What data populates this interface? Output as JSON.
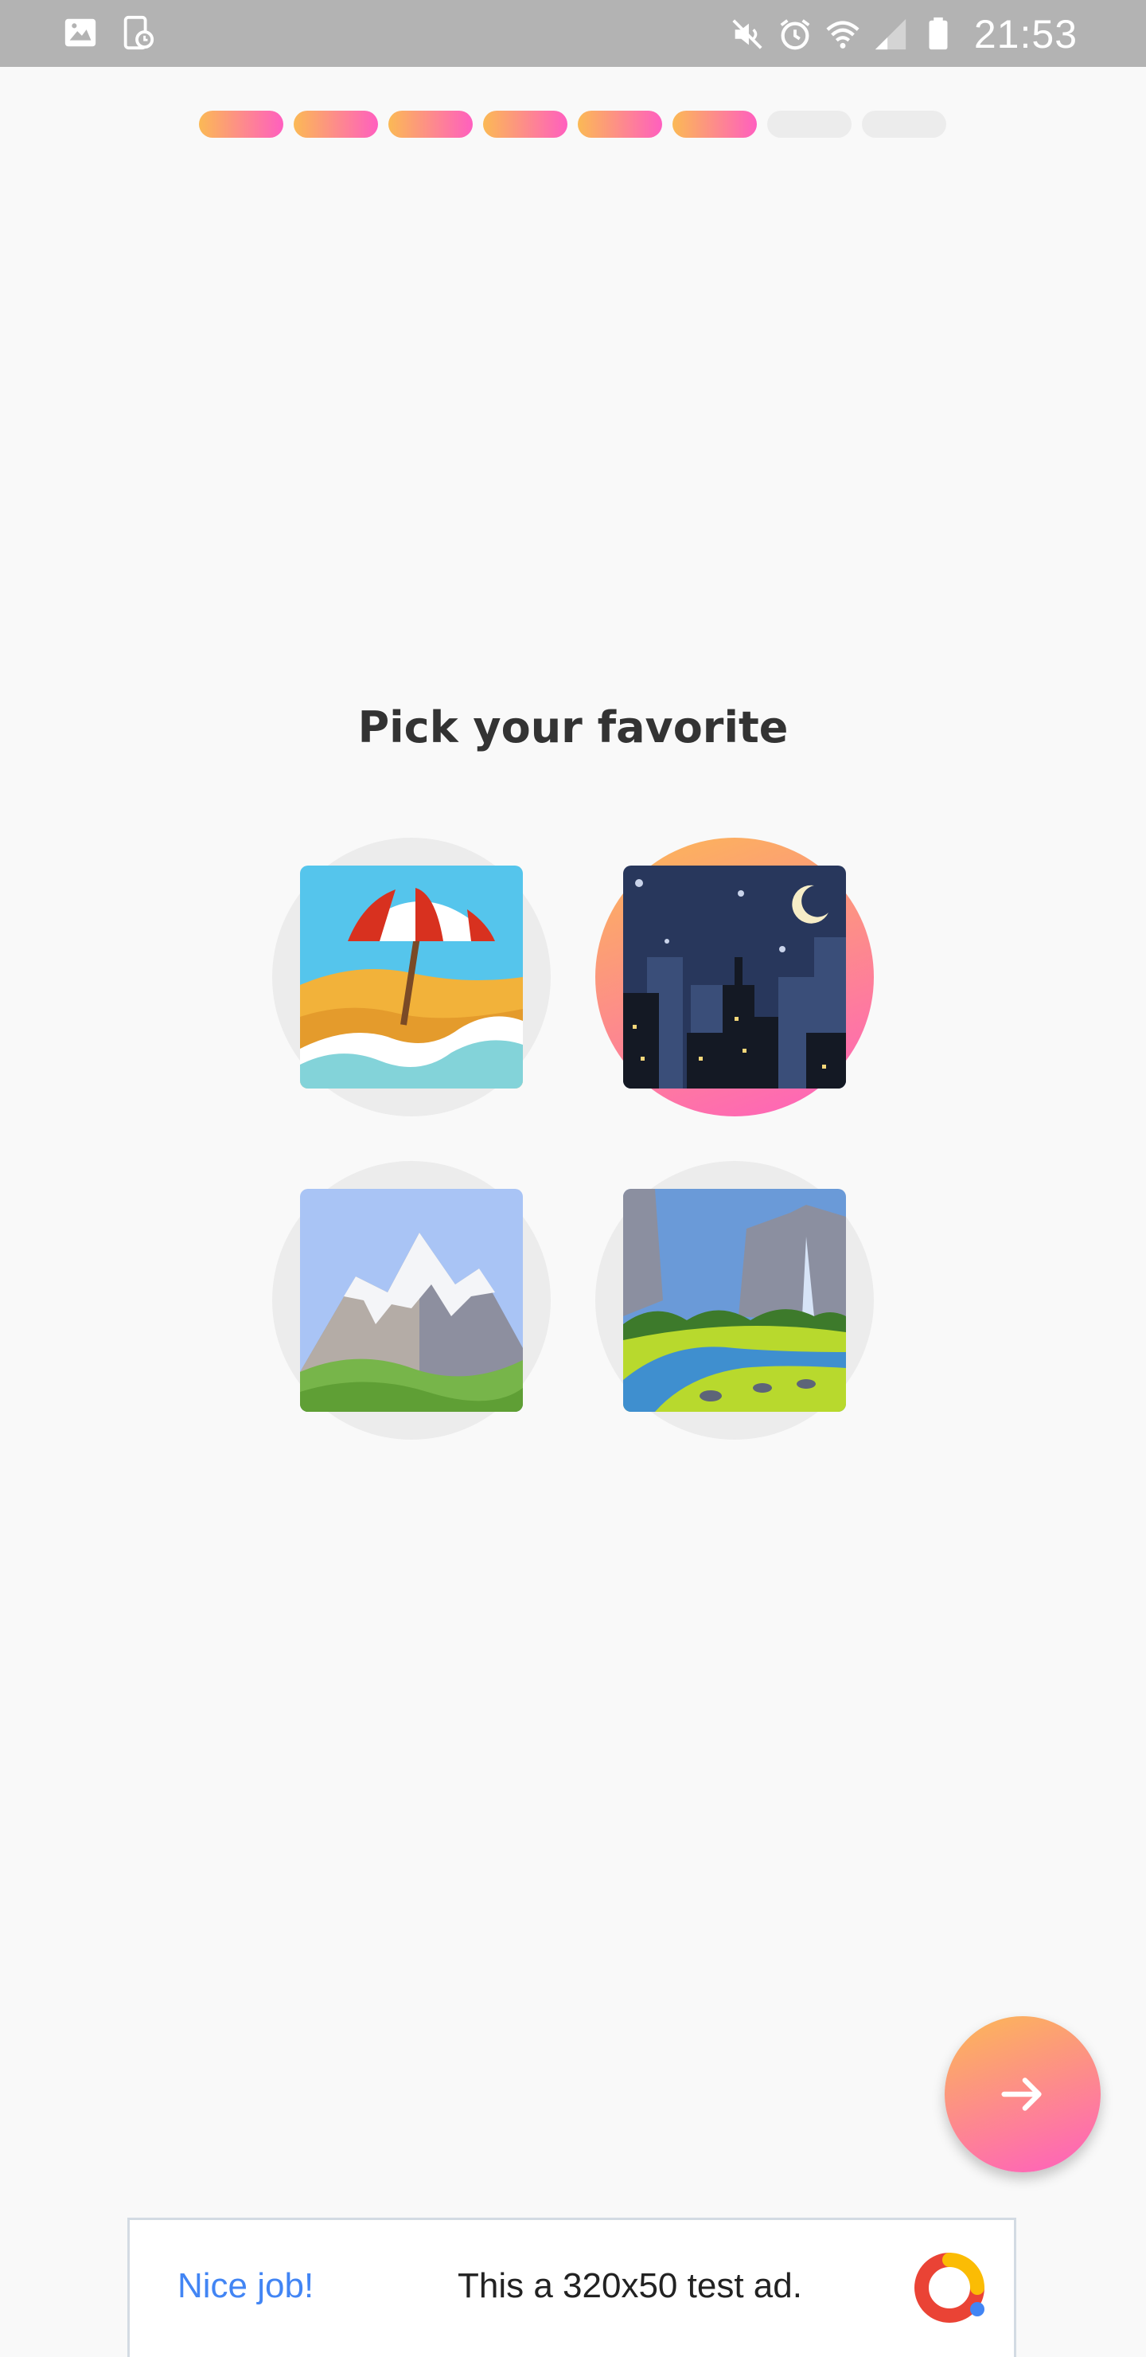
{
  "status_bar": {
    "time": "21:53",
    "left_icons": [
      "image-icon",
      "screenshot-icon"
    ],
    "right_icons": [
      "mute-icon",
      "alarm-icon",
      "wifi-icon",
      "signal-icon",
      "battery-icon"
    ]
  },
  "progress": {
    "total_steps": 8,
    "completed_steps": 6
  },
  "title": "Pick your favorite",
  "options": [
    {
      "name": "beach-with-umbrella",
      "selected": false
    },
    {
      "name": "night-with-stars",
      "selected": true
    },
    {
      "name": "snow-capped-mountain",
      "selected": false
    },
    {
      "name": "national-park",
      "selected": false
    }
  ],
  "next_button": {
    "icon": "arrow-right-icon"
  },
  "ad": {
    "label": "Nice job!",
    "text": "This a 320x50 test ad.",
    "logo": "ad-logo-icon"
  },
  "colors": {
    "accent_start": "#fbb955",
    "accent_end": "#ff5fbf",
    "ad_link": "#4285f4",
    "status_bar": "#b3b3b3"
  }
}
